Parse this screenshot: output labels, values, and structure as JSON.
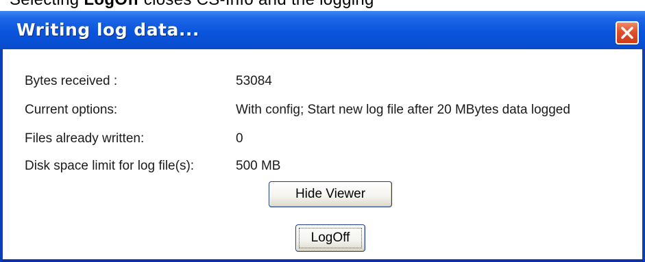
{
  "background_caption": {
    "prefix": "Selecting ",
    "bold": "LogOff",
    "suffix": " closes CS-Info and the logging"
  },
  "window": {
    "title": "Writing log data...",
    "close_icon": "close-icon",
    "colors": {
      "titlebar": "#0a54dc",
      "close_button": "#e0502c"
    }
  },
  "fields": [
    {
      "label": "Bytes received :",
      "value": "53084"
    },
    {
      "label": "Current options:",
      "value": "With config; Start new log file after 20 MBytes data logged"
    },
    {
      "label": "Files already written:",
      "value": "0"
    },
    {
      "label": "Disk space limit for log file(s):",
      "value": "500 MB"
    }
  ],
  "buttons": {
    "hide_viewer": "Hide Viewer",
    "logoff": "LogOff"
  }
}
